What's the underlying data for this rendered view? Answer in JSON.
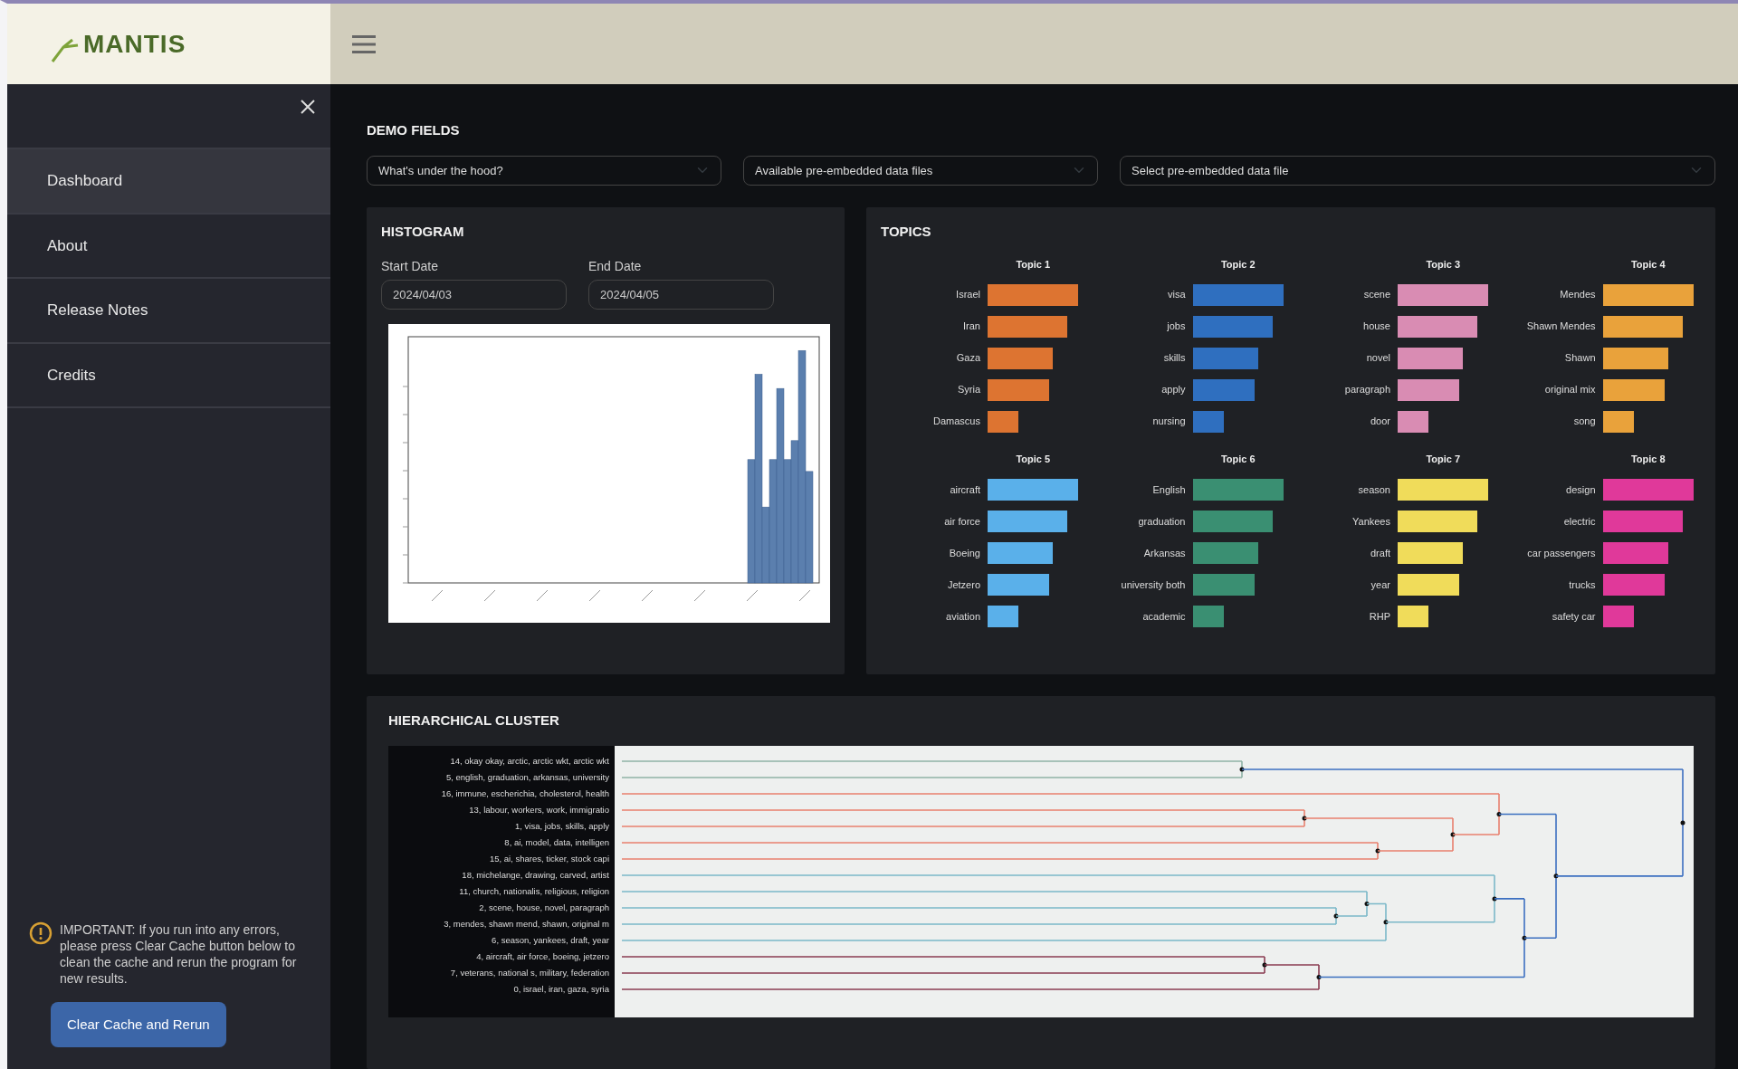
{
  "header": {
    "logo": "MANTIS"
  },
  "sidebar": {
    "items": [
      {
        "label": "Dashboard",
        "selected": true
      },
      {
        "label": "About",
        "selected": false
      },
      {
        "label": "Release Notes",
        "selected": false
      },
      {
        "label": "Credits",
        "selected": false
      }
    ],
    "notice": "IMPORTANT: If you run into any errors, please press Clear Cache button below to clean the cache and rerun the program for new results.",
    "button": "Clear Cache and Rerun"
  },
  "demo_fields": {
    "title": "DEMO FIELDS",
    "selects": [
      {
        "value": "What's under the hood?"
      },
      {
        "value": "Available pre-embedded data files"
      },
      {
        "value": "Select pre-embedded data file"
      }
    ]
  },
  "histogram": {
    "title": "HISTOGRAM",
    "start_date": {
      "label": "Start Date",
      "value": "2024/04/03"
    },
    "end_date": {
      "label": "End Date",
      "value": "2024/04/05"
    }
  },
  "topics": {
    "title": "TOPICS",
    "items": [
      {
        "label": "Topic 1",
        "color": "#dd7431",
        "terms": [
          "Israel",
          "Iran",
          "Gaza",
          "Syria",
          "Damascus"
        ]
      },
      {
        "label": "Topic 2",
        "color": "#2f6fbf",
        "terms": [
          "visa",
          "jobs",
          "skills",
          "apply",
          "nursing"
        ]
      },
      {
        "label": "Topic 3",
        "color": "#d98cb3",
        "terms": [
          "scene",
          "house",
          "novel",
          "paragraph",
          "door"
        ]
      },
      {
        "label": "Topic 4",
        "color": "#e9a23b",
        "terms": [
          "Mendes",
          "Shawn Mendes",
          "Shawn",
          "original mix",
          "song"
        ]
      },
      {
        "label": "Topic 5",
        "color": "#5ab0ea",
        "terms": [
          "aircraft",
          "air force",
          "Boeing",
          "Jetzero",
          "aviation"
        ]
      },
      {
        "label": "Topic 6",
        "color": "#3a8f72",
        "terms": [
          "English",
          "graduation",
          "Arkansas",
          "university both",
          "academic"
        ]
      },
      {
        "label": "Topic 7",
        "color": "#f0dc5a",
        "terms": [
          "season",
          "Yankees",
          "draft",
          "year",
          "RHP"
        ]
      },
      {
        "label": "Topic 8",
        "color": "#e0399a",
        "terms": [
          "design",
          "electric",
          "car passengers",
          "trucks",
          "safety car"
        ]
      }
    ]
  },
  "cluster": {
    "title": "HIERARCHICAL CLUSTER",
    "leaves": [
      "14, okay okay, arctic, arctic wkt, arctic wkt",
      "5, english, graduation, arkansas, university",
      "16, immune, escherichia, cholesterol, health",
      "13, labour, workers, work, immigratio",
      "1, visa, jobs, skills, apply",
      "8, ai, model, data, intelligen",
      "15, ai, shares, ticker, stock capi",
      "18, michelange, drawing, carved, artist",
      "11, church, nationalis, religious, religion",
      "2, scene, house, novel, paragraph",
      "3, mendes, shawn mend, shawn, original m",
      "6, season, yankees, draft, year",
      "4, aircraft, air force, boeing, jetzero",
      "7, veterans, national s, military, federation",
      "0, israel, iran, gaza, syria"
    ]
  }
}
